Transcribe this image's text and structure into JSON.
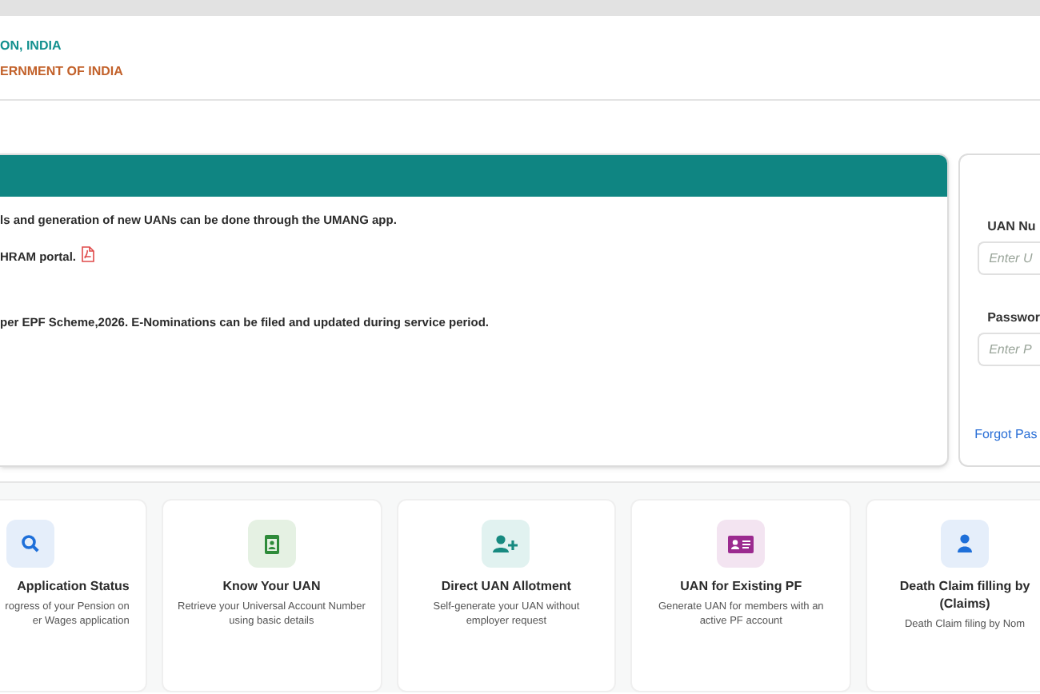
{
  "header": {
    "line_1": "ON, INDIA",
    "line_2": "ERNMENT OF INDIA"
  },
  "notice": {
    "lines": [
      {
        "text": "ls and generation of new UANs can be done through the UMANG app.",
        "pdf": false
      },
      {
        "text": "HRAM portal.",
        "pdf": true
      },
      {
        "text": "per EPF Scheme,2026. E-Nominations can be filed and updated during service period.",
        "pdf": false
      }
    ]
  },
  "login": {
    "fields": [
      {
        "label": "UAN Nu",
        "placeholder": "Enter U"
      },
      {
        "label": "Passwor",
        "placeholder": "Enter P"
      }
    ],
    "forgot_link": "Forgot Pas"
  },
  "services": [
    {
      "kind": "search",
      "title_lines": [
        "Application Status"
      ],
      "description_lines": [
        "rogress of your Pension on",
        "er Wages application"
      ]
    },
    {
      "kind": "id-card",
      "title_lines": [
        "Know Your UAN"
      ],
      "description_lines": [
        "Retrieve your Universal Account Number",
        "using basic details"
      ]
    },
    {
      "kind": "user-plus",
      "title_lines": [
        "Direct UAN Allotment"
      ],
      "description_lines": [
        "Self-generate your UAN without",
        "employer request"
      ]
    },
    {
      "kind": "card",
      "title_lines": [
        "UAN for Existing PF"
      ],
      "description_lines": [
        "Generate UAN for members with an",
        "active PF account"
      ]
    },
    {
      "kind": "user",
      "title_lines": [
        "Death Claim filling by",
        "(Claims)"
      ],
      "description_lines": [
        "Death Claim filing by Nom"
      ]
    }
  ]
}
